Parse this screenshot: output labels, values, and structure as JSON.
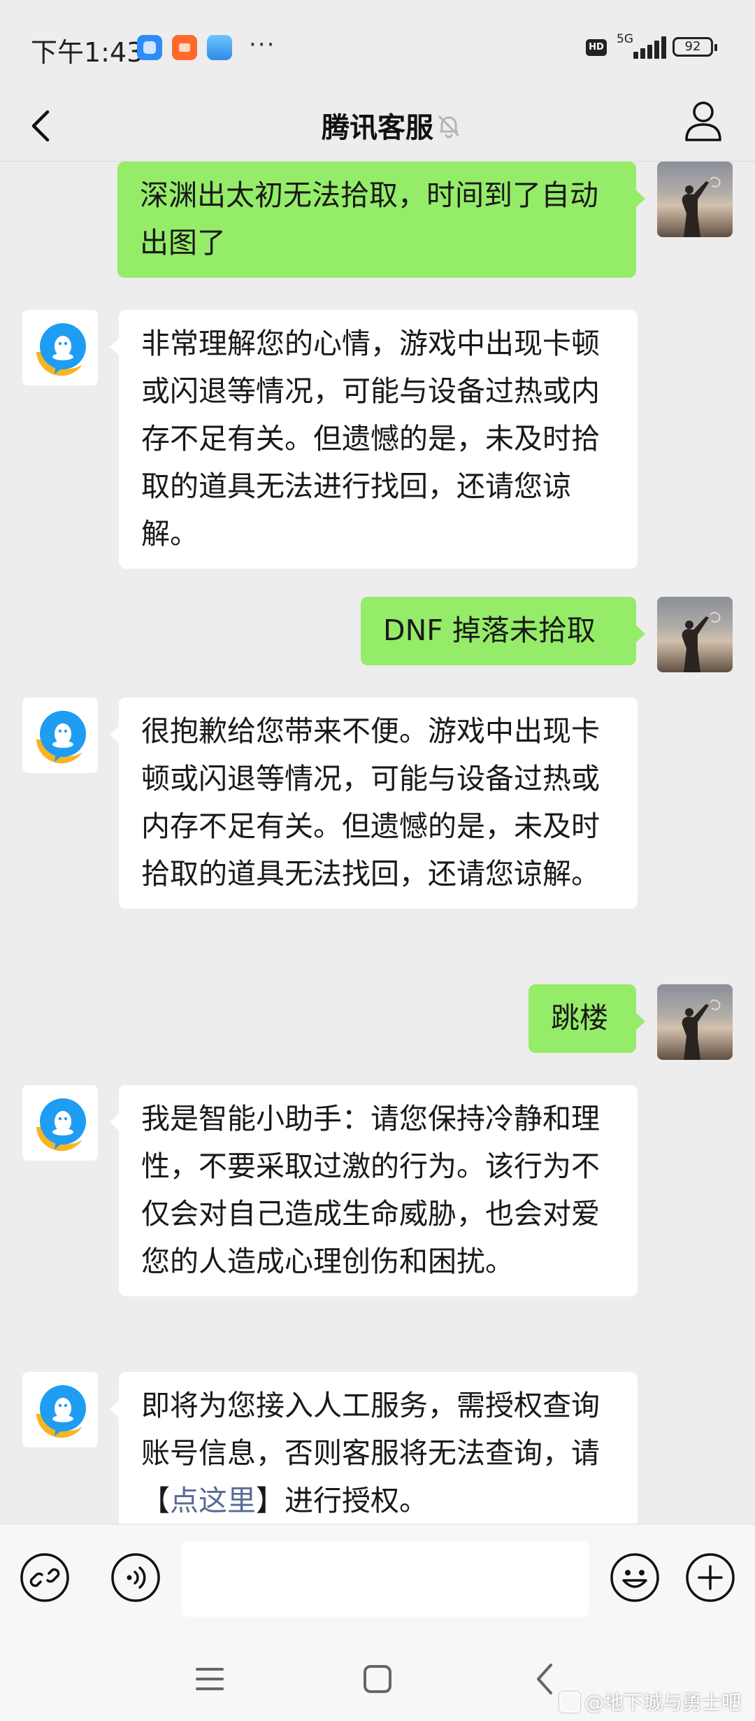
{
  "status_bar": {
    "time": "下午1:43",
    "more": "···",
    "hd": "HD",
    "network": "5G",
    "battery": "92"
  },
  "header": {
    "title": "腾讯客服"
  },
  "messages": [
    {
      "from": "me",
      "text": "深渊出太初无法拾取，时间到了自动出图了"
    },
    {
      "from": "cs",
      "text": "非常理解您的心情，游戏中出现卡顿或闪退等情况，可能与设备过热或内存不足有关。但遗憾的是，未及时拾取的道具无法进行找回，还请您谅解。"
    },
    {
      "from": "me",
      "text": "DNF 掉落未拾取"
    },
    {
      "from": "cs",
      "text": "很抱歉给您带来不便。游戏中出现卡顿或闪退等情况，可能与设备过热或内存不足有关。但遗憾的是，未及时拾取的道具无法找回，还请您谅解。"
    },
    {
      "from": "me",
      "text": "跳楼"
    },
    {
      "from": "cs",
      "text": "我是智能小助手：请您保持冷静和理性，不要采取过激的行为。该行为不仅会对自己造成生命威胁，也会对爱您的人造成心理创伤和困扰。"
    },
    {
      "from": "cs",
      "text_before": "即将为您接入人工服务，需授权查询账号信息，否则客服将无法查询，请【",
      "link": "点这里",
      "text_after": "】进行授权。"
    }
  ],
  "input": {
    "value": "",
    "placeholder": ""
  },
  "watermark": "@地下城与勇士吧",
  "colors": {
    "my_bubble": "#95ec69",
    "cs_bubble": "#ffffff",
    "link": "#576b95",
    "background": "#ededed"
  },
  "icons": [
    "chevron-left-icon",
    "bell-off-icon",
    "person-icon",
    "link-icon",
    "voice-icon",
    "emoji-icon",
    "plus-icon",
    "menu-icon",
    "home-square-icon",
    "back-arrow-icon"
  ]
}
